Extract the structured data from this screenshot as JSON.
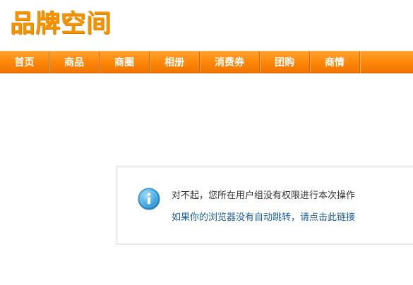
{
  "header": {
    "logo_text": "品牌空间"
  },
  "nav": {
    "items": [
      {
        "label": "首页"
      },
      {
        "label": "商品"
      },
      {
        "label": "商圈"
      },
      {
        "label": "相册"
      },
      {
        "label": "消费券"
      },
      {
        "label": "团购"
      },
      {
        "label": "商情"
      }
    ]
  },
  "message": {
    "icon": "info-icon",
    "text": "对不起，您所在用户组没有权限进行本次操作",
    "redirect_link": "如果你的浏览器没有自动跳转，请点击此链接"
  },
  "colors": {
    "brand_orange": "#f39300",
    "nav_orange": "#ff8a0c",
    "link_blue": "#1c5d9a",
    "icon_blue": "#3ba2dc"
  }
}
